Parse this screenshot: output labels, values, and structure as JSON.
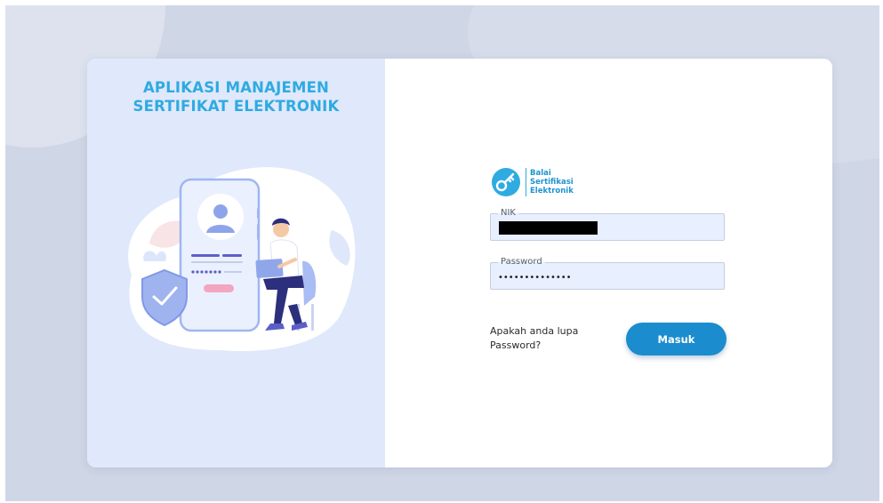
{
  "app": {
    "title_line1": "APLIKASI MANAJEMEN",
    "title_line2": "SERTIFIKAT ELEKTRONIK"
  },
  "logo": {
    "icon": "key-icon",
    "line1": "Balai",
    "line2": "Sertifikasi",
    "line3": "Elektronik"
  },
  "form": {
    "nik": {
      "label": "NIK",
      "value": "",
      "redacted": true
    },
    "password": {
      "label": "Password",
      "value": "••••••••••••••"
    },
    "forgot_password": "Apakah anda lupa Password?",
    "submit_label": "Masuk"
  },
  "colors": {
    "accent": "#2eabe1",
    "button": "#1b8ccd",
    "panel_bg": "#e0e8fb",
    "input_bg": "#e8effe",
    "backdrop": "#cfd6e6"
  }
}
